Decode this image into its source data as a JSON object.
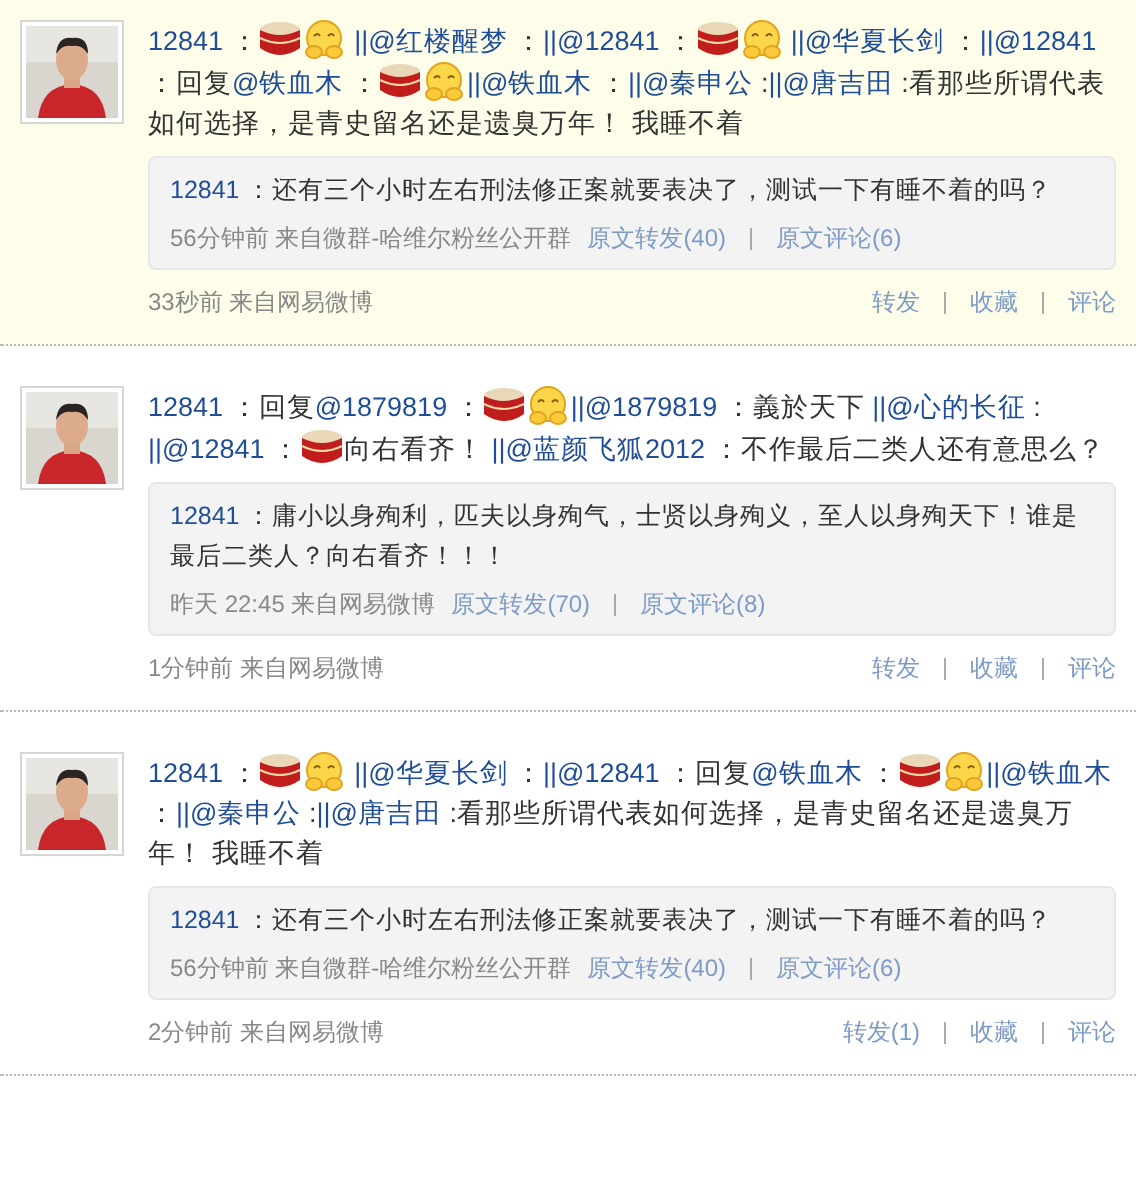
{
  "posts": [
    {
      "highlighted": true,
      "content": [
        {
          "kind": "link",
          "text": "12841"
        },
        {
          "kind": "text",
          "text": " ："
        },
        {
          "kind": "drum"
        },
        {
          "kind": "smile"
        },
        {
          "kind": "link",
          "text": " ||@红楼醒梦"
        },
        {
          "kind": "text",
          "text": " ："
        },
        {
          "kind": "link",
          "text": "||@12841"
        },
        {
          "kind": "text",
          "text": " ："
        },
        {
          "kind": "drum"
        },
        {
          "kind": "smile"
        },
        {
          "kind": "link",
          "text": " ||@华夏长剑"
        },
        {
          "kind": "text",
          "text": " ："
        },
        {
          "kind": "link",
          "text": "||@12841"
        },
        {
          "kind": "text",
          "text": " ：回复"
        },
        {
          "kind": "link",
          "text": "@铁血木"
        },
        {
          "kind": "text",
          "text": " ："
        },
        {
          "kind": "drum"
        },
        {
          "kind": "smile"
        },
        {
          "kind": "link",
          "text": "||@铁血木"
        },
        {
          "kind": "text",
          "text": " ："
        },
        {
          "kind": "link",
          "text": "||@秦申公"
        },
        {
          "kind": "text",
          "text": " :"
        },
        {
          "kind": "link",
          "text": "||@唐吉田"
        },
        {
          "kind": "text",
          "text": " :看那些所谓代表如何选择，是青史留名还是遗臭万年！ 我睡不着"
        }
      ],
      "quote": {
        "author": "12841",
        "text": "：还有三个小时左右刑法修正案就要表决了，测试一下有睡不着的吗？",
        "meta": "56分钟前 来自微群-哈维尔粉丝公开群",
        "links": [
          "原文转发(40)",
          "原文评论(6)"
        ]
      },
      "meta": "33秒前 来自网易微博",
      "actions": [
        "转发",
        "收藏",
        "评论"
      ]
    },
    {
      "highlighted": false,
      "content": [
        {
          "kind": "link",
          "text": "12841"
        },
        {
          "kind": "text",
          "text": " ：回复"
        },
        {
          "kind": "link",
          "text": "@1879819"
        },
        {
          "kind": "text",
          "text": " ："
        },
        {
          "kind": "drum"
        },
        {
          "kind": "smile"
        },
        {
          "kind": "link",
          "text": "||@1879819"
        },
        {
          "kind": "text",
          "text": " ：義於天下 "
        },
        {
          "kind": "link",
          "text": "||@心的长征"
        },
        {
          "kind": "text",
          "text": " :"
        },
        {
          "kind": "link",
          "text": "||@12841"
        },
        {
          "kind": "text",
          "text": " ："
        },
        {
          "kind": "drum"
        },
        {
          "kind": "text",
          "text": "向右看齐！ "
        },
        {
          "kind": "link",
          "text": "||@蓝颜飞狐2012"
        },
        {
          "kind": "text",
          "text": " ：不作最后二类人还有意思么？"
        }
      ],
      "quote": {
        "author": "12841",
        "text": "：庸小以身殉利，匹夫以身殉气，士贤以身殉义，至人以身殉天下！谁是最后二类人？向右看齐！！！",
        "meta": "昨天 22:45 来自网易微博",
        "links": [
          "原文转发(70)",
          "原文评论(8)"
        ]
      },
      "meta": "1分钟前 来自网易微博",
      "actions": [
        "转发",
        "收藏",
        "评论"
      ]
    },
    {
      "highlighted": false,
      "content": [
        {
          "kind": "link",
          "text": "12841"
        },
        {
          "kind": "text",
          "text": " ："
        },
        {
          "kind": "drum"
        },
        {
          "kind": "smile"
        },
        {
          "kind": "link",
          "text": " ||@华夏长剑"
        },
        {
          "kind": "text",
          "text": " ："
        },
        {
          "kind": "link",
          "text": "||@12841"
        },
        {
          "kind": "text",
          "text": " ：回复"
        },
        {
          "kind": "link",
          "text": "@铁血木"
        },
        {
          "kind": "text",
          "text": " ："
        },
        {
          "kind": "drum"
        },
        {
          "kind": "smile"
        },
        {
          "kind": "link",
          "text": "||@铁血木"
        },
        {
          "kind": "text",
          "text": " ："
        },
        {
          "kind": "link",
          "text": "||@秦申公"
        },
        {
          "kind": "text",
          "text": " :"
        },
        {
          "kind": "link",
          "text": "||@唐吉田"
        },
        {
          "kind": "text",
          "text": " :看那些所谓代表如何选择，是青史留名还是遗臭万年！ 我睡不着"
        }
      ],
      "quote": {
        "author": "12841",
        "text": "：还有三个小时左右刑法修正案就要表决了，测试一下有睡不着的吗？",
        "meta": "56分钟前 来自微群-哈维尔粉丝公开群",
        "links": [
          "原文转发(40)",
          "原文评论(6)"
        ]
      },
      "meta": "2分钟前 来自网易微博",
      "actions": [
        "转发(1)",
        "收藏",
        "评论"
      ]
    }
  ]
}
